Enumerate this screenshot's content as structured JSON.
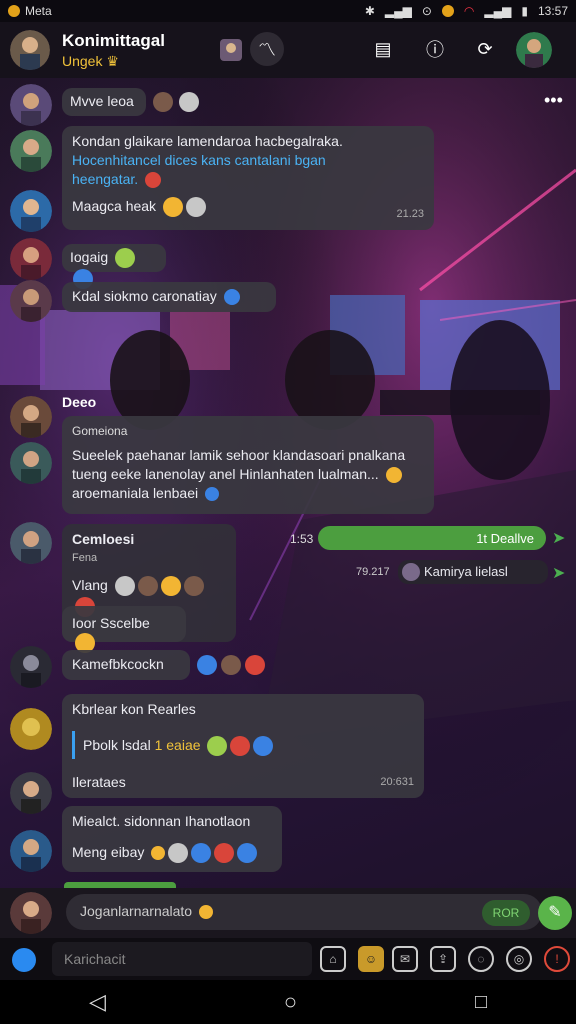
{
  "status": {
    "left": "Meta",
    "time": "13:57"
  },
  "header": {
    "title": "Konimittagal",
    "subtitle": "Ungek"
  },
  "messages": {
    "m1": "Mvve leoa",
    "m2_line1": "Kondan glaikare lamendaroa hacbegalraka.",
    "m2_line2": "Hocenhitancel dices kans cantalani bgan",
    "m2_line3": "heengatar.",
    "m3": "Maagca heak",
    "m3_time": "21.23",
    "m4": "Iogaig",
    "m5": "Kdal siokmo caronatiay",
    "m6_name": "Deeo",
    "m6_sub": "Gomeiona",
    "m6_line1": "Sueelek paehanar lamik sehoor klandasoari pnalkana",
    "m6_line2": "tueng eeke lanenolay anel Hinlanhaten lualman...",
    "m6_line3": "aroemaniala lenbaei",
    "m7_name": "Cemloesi",
    "m7_sub": "Fena",
    "m7_line": "Vlang",
    "m7_green_time": "1:53",
    "m7_green": "1t Deallve",
    "m7_time2": "79.217",
    "m7_right": "Kamirya lielasl",
    "m8": "Ioor Sscelbe",
    "m9": "Kamefbkcockn",
    "m10_title": "Kbrlear kon Rearles",
    "m10_quote": "Pbolk lsdal",
    "m10_quote_hl": "1 eaiae",
    "m10_footer": "Ilerataes",
    "m10_time": "20:631",
    "m11_line1": "Miealct. sidonnan Ihanotlaon",
    "m11_line2": "Meng eibay"
  },
  "input": {
    "text": "Joganlarnarnalato",
    "send_pill": "ROR"
  },
  "bottom": {
    "placeholder": "Karichacit"
  }
}
